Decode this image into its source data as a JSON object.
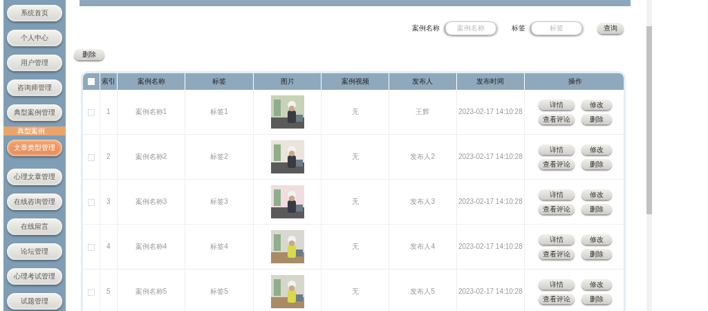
{
  "sidebar": {
    "items": [
      {
        "kind": "button",
        "label": "系统首页",
        "selected": false
      },
      {
        "kind": "button",
        "label": "个人中心",
        "selected": false
      },
      {
        "kind": "button",
        "label": "用户管理",
        "selected": false
      },
      {
        "kind": "button",
        "label": "咨询师管理",
        "selected": false
      },
      {
        "kind": "button",
        "label": "典型案例管理",
        "selected": false
      },
      {
        "kind": "header",
        "label": "典型案例"
      },
      {
        "kind": "button",
        "label": "文章类型管理",
        "selected": true
      },
      {
        "kind": "band"
      },
      {
        "kind": "button",
        "label": "心理文章管理",
        "selected": false
      },
      {
        "kind": "button",
        "label": "在线咨询管理",
        "selected": false
      },
      {
        "kind": "button",
        "label": "在线留言",
        "selected": false
      },
      {
        "kind": "button",
        "label": "论坛管理",
        "selected": false
      },
      {
        "kind": "button",
        "label": "心理考试管理",
        "selected": false
      },
      {
        "kind": "button",
        "label": "试题管理",
        "selected": false
      }
    ]
  },
  "search": {
    "fields": [
      {
        "label": "案例名称",
        "placeholder": "案例名称"
      },
      {
        "label": "标签",
        "placeholder": "标签"
      }
    ],
    "button": "查询"
  },
  "toolbar": {
    "delete_button": "删除"
  },
  "table": {
    "header_checkbox": {
      "checked": false
    },
    "columns": [
      "索引",
      "案例名称",
      "标签",
      "图片",
      "案例视频",
      "发布人",
      "发布时间",
      "操作"
    ],
    "rows": [
      {
        "checked": false,
        "index": "1",
        "name": "案例名称1",
        "tag": "标签1",
        "image": {
          "kind": "picture"
        },
        "video": "无",
        "publisher": "王辉",
        "time": "2023-02-17 14:10:28",
        "actions": [
          "详情",
          "修改",
          "查看评论",
          "删除"
        ]
      },
      {
        "checked": false,
        "index": "2",
        "name": "案例名称2",
        "tag": "标签2",
        "image": {
          "kind": "picture"
        },
        "video": "无",
        "publisher": "发布人2",
        "time": "2023-02-17 14:10:28",
        "actions": [
          "详情",
          "修改",
          "查看评论",
          "删除"
        ]
      },
      {
        "checked": false,
        "index": "3",
        "name": "案例名称3",
        "tag": "标签3",
        "image": {
          "kind": "picture"
        },
        "video": "无",
        "publisher": "发布人3",
        "time": "2023-02-17 14:10:28",
        "actions": [
          "详情",
          "修改",
          "查看评论",
          "删除"
        ]
      },
      {
        "checked": false,
        "index": "4",
        "name": "案例名称4",
        "tag": "标签4",
        "image": {
          "kind": "picture"
        },
        "video": "无",
        "publisher": "发布人4",
        "time": "2023-02-17 14:10:28",
        "actions": [
          "详情",
          "修改",
          "查看评论",
          "删除"
        ]
      },
      {
        "checked": false,
        "index": "5",
        "name": "案例名称5",
        "tag": "标签5",
        "image": {
          "kind": "picture"
        },
        "video": "无",
        "publisher": "发布人5",
        "time": "2023-02-17 14:10:28",
        "actions": [
          "详情",
          "修改",
          "查看评论",
          "删除"
        ]
      }
    ]
  }
}
